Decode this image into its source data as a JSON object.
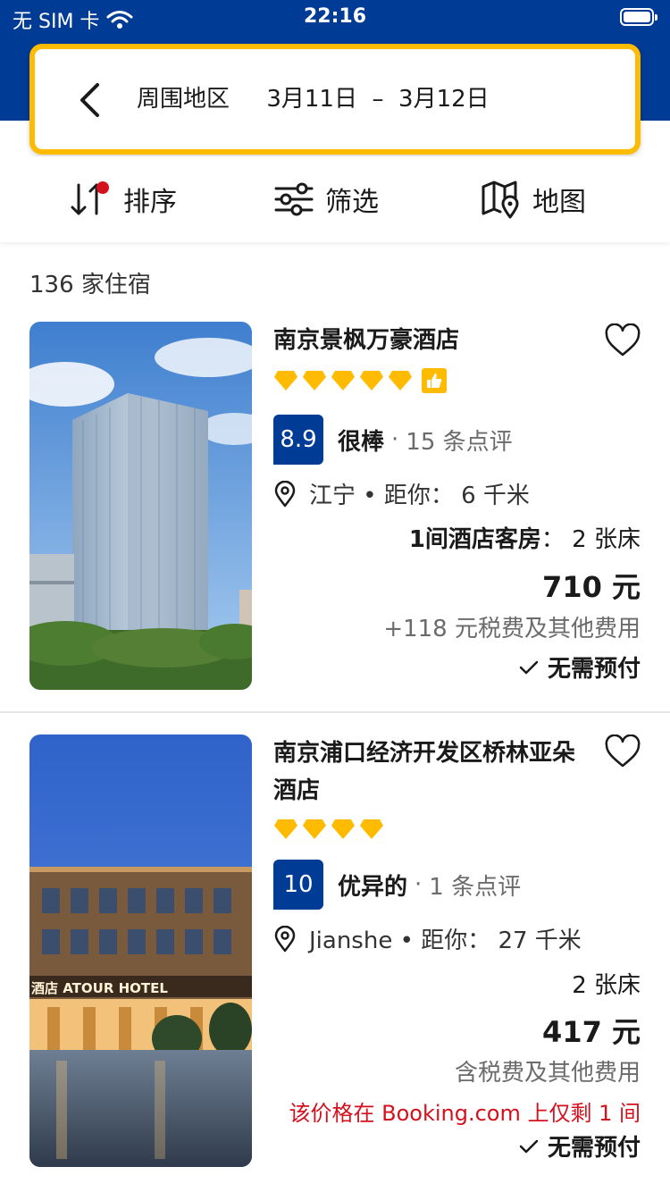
{
  "status_bar": {
    "carrier": "无 SIM 卡",
    "time": "22:16"
  },
  "search": {
    "destination": "周围地区",
    "check_in": "3月11日",
    "separator": "–",
    "check_out": "3月12日"
  },
  "toolbar": {
    "sort_label": "排序",
    "filter_label": "筛选",
    "map_label": "地图"
  },
  "results": {
    "count_text": "136 家住宿"
  },
  "colors": {
    "brand_blue": "#003b95",
    "accent_yellow": "#febb02",
    "alert_red": "#d4111e"
  },
  "hotels": [
    {
      "name": "南京景枫万豪酒店",
      "stars": 5,
      "has_preferred_badge": true,
      "score": "8.9",
      "score_word": "很棒",
      "score_separator": "·",
      "reviews": "15 条点评",
      "location": "江宁 • 距你： 6 千米",
      "room_type": "1间酒店客房",
      "beds": "： 2 张床",
      "price": "710 元",
      "tax_note": "+118 元税费及其他费用",
      "payment": "无需预付"
    },
    {
      "name": "南京浦口经济开发区桥林亚朵酒店",
      "stars": 4,
      "has_preferred_badge": false,
      "score": "10",
      "score_word": "优异的",
      "score_separator": "·",
      "reviews": "1 条点评",
      "location": "Jianshe • 距你： 27 千米",
      "beds": "2 张床",
      "price": "417 元",
      "tax_note": "含税费及其他费用",
      "scarcity": "该价格在 Booking.com 上仅剩 1 间",
      "photo_sign": "酒店 ATOUR HOTEL",
      "payment": "无需预付"
    }
  ]
}
